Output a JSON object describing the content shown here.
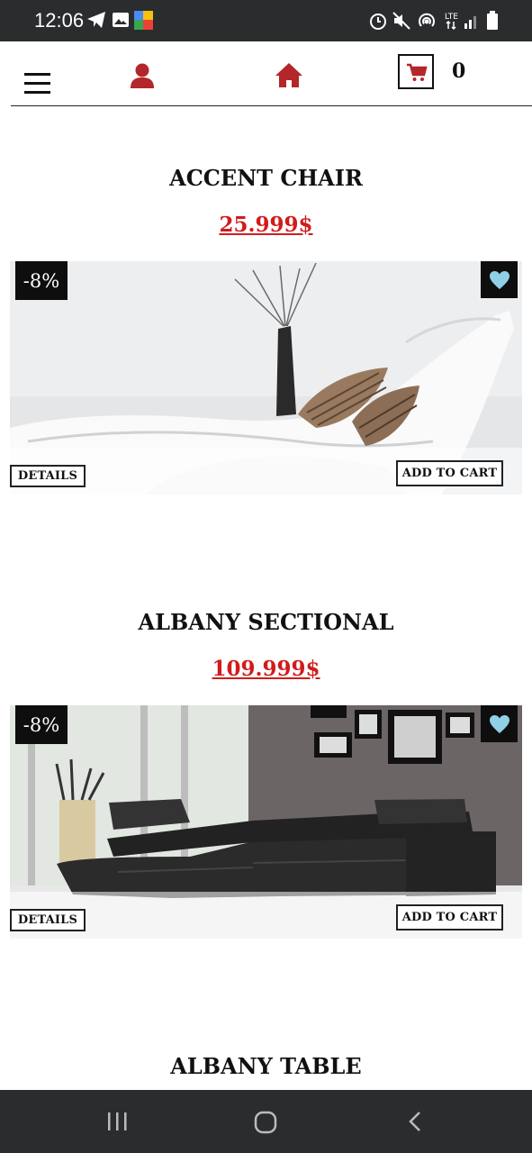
{
  "status_bar": {
    "time": "12:06"
  },
  "header": {
    "cart_count": "0"
  },
  "products": [
    {
      "title": "ACCENT CHAIR",
      "price": "25.999$",
      "discount": "-8%",
      "details_label": "DETAILS",
      "add_to_cart_label": "ADD TO CART"
    },
    {
      "title": "ALBANY SECTIONAL",
      "price": "109.999$",
      "discount": "-8%",
      "details_label": "DETAILS",
      "add_to_cart_label": "ADD TO CART"
    },
    {
      "title": "ALBANY TABLE"
    }
  ],
  "colors": {
    "accent": "#b3262a",
    "price": "#d11c1c",
    "wishlist_heart": "#8fd0e6",
    "status_bar": "#2b2c2e"
  },
  "icons": [
    "menu-icon",
    "user-icon",
    "home-icon",
    "cart-icon",
    "heart-icon"
  ]
}
